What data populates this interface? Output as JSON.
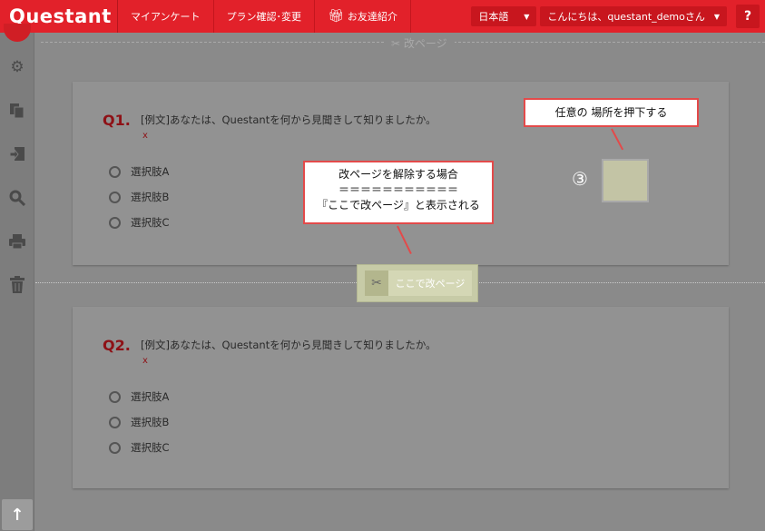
{
  "header": {
    "logo": "Questant",
    "nav": [
      {
        "label": "マイアンケート"
      },
      {
        "label": "プラン確認･変更"
      },
      {
        "label": "お友達紹介"
      }
    ],
    "language": "日本語",
    "greeting": "こんにちは、questant_demoさん",
    "help": "?"
  },
  "page_break_label": "改ページ",
  "questions": [
    {
      "number": "Q1.",
      "text": "[例文]あなたは、Questantを何から見聞きして知りましたか。",
      "required_mark": "x",
      "options": [
        "選択肢A",
        "選択肢B",
        "選択肢C"
      ]
    },
    {
      "number": "Q2.",
      "text": "[例文]あなたは、Questantを何から見聞きして知りましたか。",
      "required_mark": "x",
      "options": [
        "選択肢A",
        "選択肢B",
        "選択肢C"
      ]
    }
  ],
  "annotations": {
    "press_anywhere": "任意の 場所を押下する",
    "release_title": "改ページを解除する場合",
    "release_separator": "＝＝＝＝＝＝＝＝＝＝＝",
    "release_note": "『ここで改ページ』と表示される",
    "step_number": "③"
  },
  "page_break_button": "ここで改ページ",
  "icons": [
    "gear-icon",
    "copy-icon",
    "move-icon",
    "search-icon",
    "print-icon",
    "trash-icon",
    "scissors-icon",
    "gift-icon",
    "arrow-up-icon"
  ]
}
